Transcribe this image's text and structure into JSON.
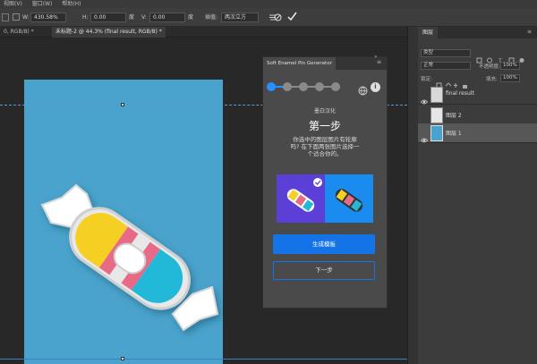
{
  "menubar": {
    "items": [
      "视图(V)",
      "窗口(W)",
      "帮助(H)"
    ]
  },
  "options": {
    "w_label": "W:",
    "w_value": "430.58%",
    "h_label": "H:",
    "h_value": "0.00",
    "v_label": "V:",
    "v_value": "0.00",
    "degree": "度",
    "interp_label": "插值:",
    "interp_value": "两次立方"
  },
  "tabs": [
    {
      "label": "0, RGB/8) *",
      "active": false
    },
    {
      "label": "未标题-2 @ 44.3% (final result, RGB/8) *",
      "active": true
    }
  ],
  "plugin": {
    "title": "Soft Enamel Pin Generator",
    "brand": "墨白汉化",
    "step_title": "第一步",
    "desc_lines": [
      "你选中的图层图片有轮廓",
      "吗? 在下面两张图片选择一",
      "个适合你的。"
    ],
    "primary_button": "生成模板",
    "secondary_button": "下一步",
    "steps_total": 5,
    "steps_current": 1
  },
  "layers_panel": {
    "tab": "图层",
    "search_placeholder": "类型",
    "blend_mode": "正常",
    "opacity_label": "不透明度:",
    "opacity_value": "100%",
    "lock_label": "锁定:",
    "fill_label": "填充:",
    "fill_value": "100%",
    "layers": [
      {
        "name": "final result",
        "visible": true,
        "selected": false
      },
      {
        "name": "图层 2",
        "visible": false,
        "selected": false
      },
      {
        "name": "图层 1",
        "visible": true,
        "selected": true
      }
    ]
  },
  "colors": {
    "accent": "#1473e6",
    "canvas": "#4aa3cc",
    "card_left": "#5b3fd6",
    "card_right": "#1a8cf0"
  }
}
